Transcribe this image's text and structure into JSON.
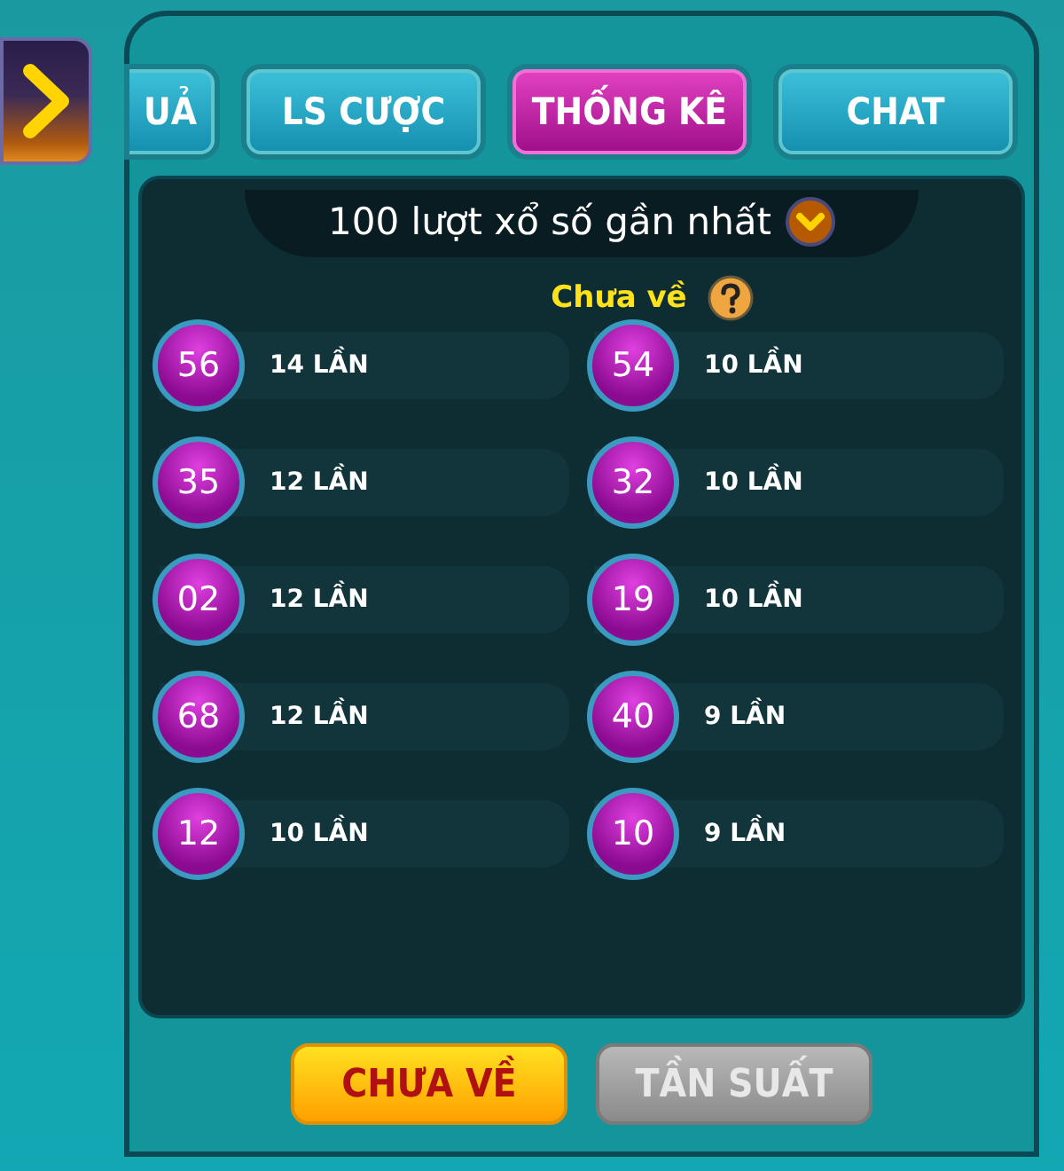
{
  "tabs": [
    {
      "label": "UẢ",
      "selected": false
    },
    {
      "label": "LS CƯỢC",
      "selected": false
    },
    {
      "label": "THỐNG KÊ",
      "selected": true
    },
    {
      "label": "CHAT",
      "selected": false
    }
  ],
  "range_selector": {
    "label": "100 lượt xổ số gần nhất"
  },
  "section_title": "Chưa về",
  "numbers": [
    {
      "number": "56",
      "count": "14 LẦN"
    },
    {
      "number": "54",
      "count": "10 LẦN"
    },
    {
      "number": "35",
      "count": "12 LẦN"
    },
    {
      "number": "32",
      "count": "10 LẦN"
    },
    {
      "number": "02",
      "count": "12 LẦN"
    },
    {
      "number": "19",
      "count": "10 LẦN"
    },
    {
      "number": "68",
      "count": "12 LẦN"
    },
    {
      "number": "40",
      "count": "9 LẦN"
    },
    {
      "number": "12",
      "count": "10 LẦN"
    },
    {
      "number": "10",
      "count": "9 LẦN"
    }
  ],
  "mode_buttons": [
    {
      "label": "CHƯA VỀ",
      "selected": true
    },
    {
      "label": "TẦN SUẤT",
      "selected": false
    }
  ]
}
